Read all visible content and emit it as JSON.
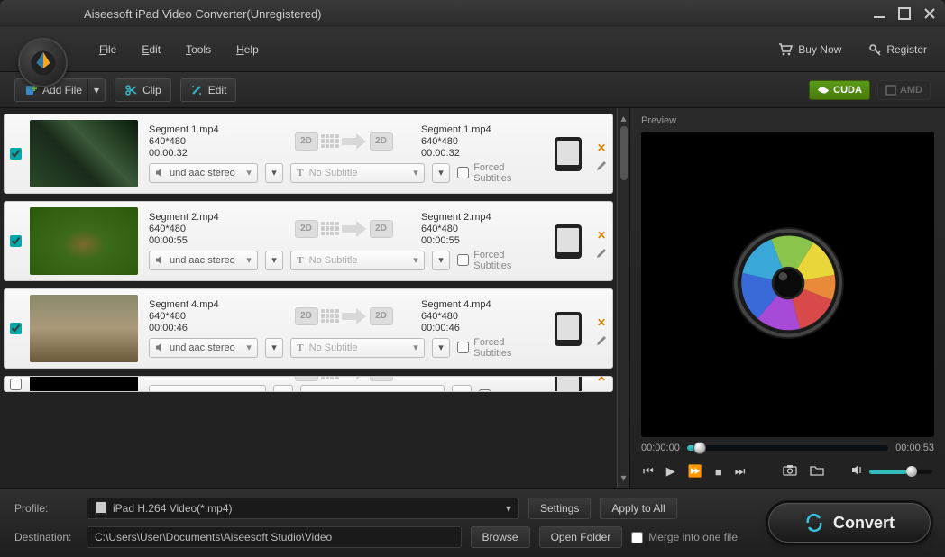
{
  "window": {
    "title": "Aiseesoft iPad Video Converter(Unregistered)"
  },
  "menus": {
    "file": "File",
    "edit": "Edit",
    "tools": "Tools",
    "help": "Help",
    "buy": "Buy Now",
    "register": "Register"
  },
  "toolbar": {
    "addfile": "Add File",
    "clip": "Clip",
    "edit": "Edit",
    "cuda": "CUDA",
    "amd": "AMD"
  },
  "preview": {
    "label": "Preview",
    "current": "00:00:00",
    "total": "00:00:53"
  },
  "list": [
    {
      "checked": true,
      "src_name": "Segment 1.mp4",
      "src_res": "640*480",
      "src_dur": "00:00:32",
      "dst_name": "Segment 1.mp4",
      "dst_res": "640*480",
      "dst_dur": "00:00:32",
      "audio": "und aac stereo",
      "subtitle": "No Subtitle",
      "forced": "Forced Subtitles",
      "thumb": "thumb1"
    },
    {
      "checked": true,
      "src_name": "Segment 2.mp4",
      "src_res": "640*480",
      "src_dur": "00:00:55",
      "dst_name": "Segment 2.mp4",
      "dst_res": "640*480",
      "dst_dur": "00:00:55",
      "audio": "und aac stereo",
      "subtitle": "No Subtitle",
      "forced": "Forced Subtitles",
      "thumb": "thumb2"
    },
    {
      "checked": true,
      "src_name": "Segment 4.mp4",
      "src_res": "640*480",
      "src_dur": "00:00:46",
      "dst_name": "Segment 4.mp4",
      "dst_res": "640*480",
      "dst_dur": "00:00:46",
      "audio": "und aac stereo",
      "subtitle": "No Subtitle",
      "forced": "Forced Subtitles",
      "thumb": "thumb3"
    }
  ],
  "bottom": {
    "profile_label": "Profile:",
    "profile_value": "iPad H.264 Video(*.mp4)",
    "settings": "Settings",
    "apply": "Apply to All",
    "dest_label": "Destination:",
    "dest_value": "C:\\Users\\User\\Documents\\Aiseesoft Studio\\Video",
    "browse": "Browse",
    "open": "Open Folder",
    "merge": "Merge into one file",
    "convert": "Convert"
  },
  "misc": {
    "badge2d": "2D"
  }
}
